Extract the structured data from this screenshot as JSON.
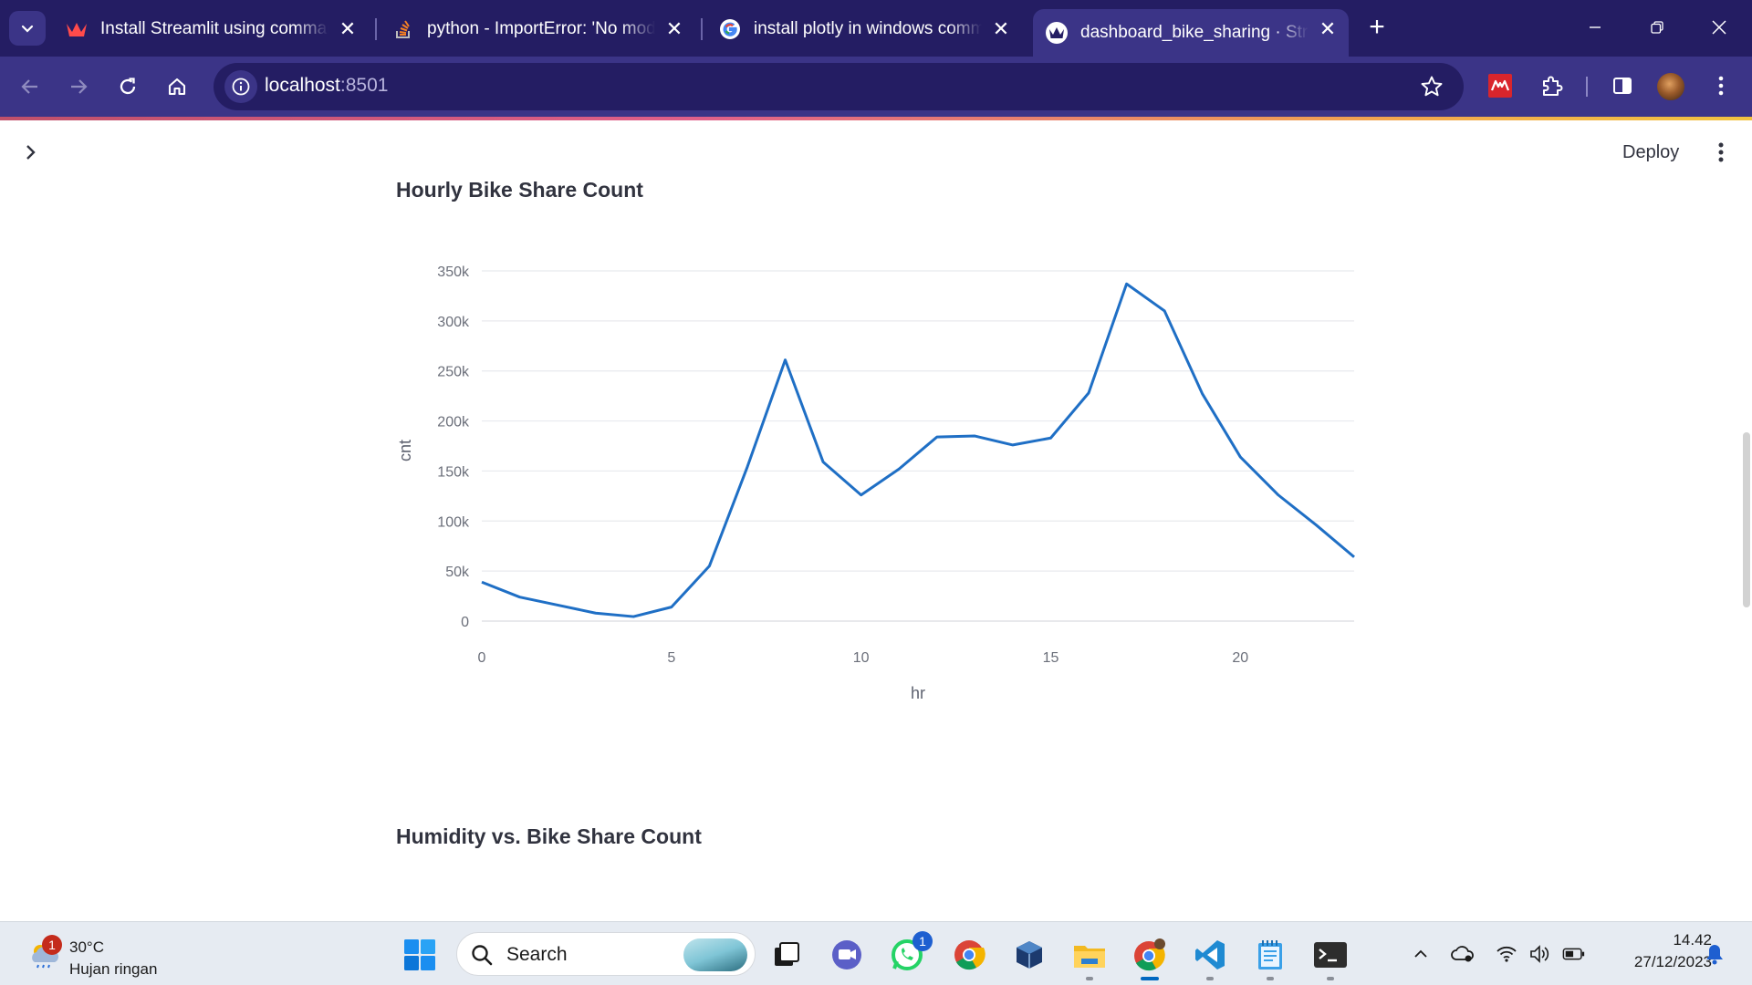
{
  "browser": {
    "tabs": [
      {
        "title": "Install Streamlit using command",
        "favicon": "streamlit-crown-icon",
        "active": false
      },
      {
        "title": "python - ImportError: 'No module",
        "favicon": "stackoverflow-icon",
        "active": false
      },
      {
        "title": "install plotly in windows comma",
        "favicon": "google-icon",
        "active": false
      },
      {
        "title": "dashboard_bike_sharing · Streamlit",
        "favicon": "streamlit-crown-icon",
        "active": true
      }
    ],
    "close_glyph": "✕",
    "new_tab_glyph": "+",
    "address": {
      "host": "localhost",
      "port": ":8501"
    }
  },
  "app": {
    "deploy_label": "Deploy",
    "sections": [
      {
        "title": "Hourly Bike Share Count"
      },
      {
        "title": "Humidity vs. Bike Share Count"
      }
    ]
  },
  "chart_data": {
    "type": "line",
    "title": "Hourly Bike Share Count",
    "xlabel": "hr",
    "ylabel": "cnt",
    "x": [
      0,
      1,
      2,
      3,
      4,
      5,
      6,
      7,
      8,
      9,
      10,
      11,
      12,
      13,
      14,
      15,
      16,
      17,
      18,
      19,
      20,
      21,
      22,
      23
    ],
    "series": [
      {
        "values": [
          39000,
          24000,
          16000,
          8000,
          4500,
          14000,
          55000,
          154000,
          261000,
          159000,
          126000,
          152000,
          184000,
          185000,
          176000,
          183000,
          228000,
          337000,
          310000,
          227000,
          164000,
          126000,
          96000,
          64000
        ],
        "color": "#1f6fc5"
      }
    ],
    "xlim": [
      0,
      23
    ],
    "ylim": [
      0,
      350000
    ],
    "x_ticks": [
      0,
      5,
      10,
      15,
      20
    ],
    "x_tick_labels": [
      "0",
      "5",
      "10",
      "15",
      "20"
    ],
    "y_ticks": [
      0,
      50000,
      100000,
      150000,
      200000,
      250000,
      300000,
      350000
    ],
    "y_tick_labels": [
      "0",
      "50k",
      "100k",
      "150k",
      "200k",
      "250k",
      "300k",
      "350k"
    ],
    "grid": true,
    "legend": "none"
  },
  "taskbar": {
    "weather": {
      "temp": "30°C",
      "desc": "Hujan ringan",
      "badge": "1"
    },
    "search_label": "Search",
    "apps": [
      "windows-start-icon",
      "search-box",
      "task-view-icon",
      "teams-chat-icon",
      "whatsapp-icon",
      "chrome-icon",
      "virtualbox-icon",
      "file-explorer-icon",
      "chrome-profile-icon",
      "vscode-icon",
      "notepad-icon",
      "terminal-icon"
    ],
    "whatsapp_badge": "1",
    "clock": {
      "time": "14.42",
      "date": "27/12/2023"
    }
  }
}
